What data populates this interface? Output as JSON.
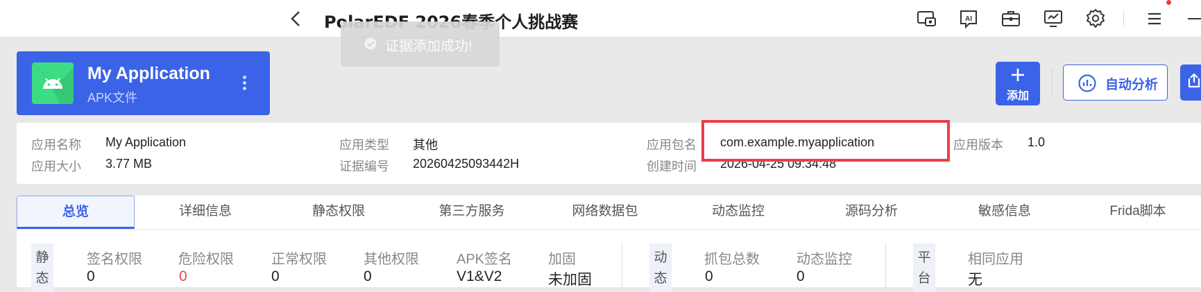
{
  "header": {
    "title": "PolarEDF 2026春季个人挑战赛",
    "toolbar_icons": [
      "screen-record-icon",
      "ai-icon",
      "toolbox-icon",
      "monitor-chart-icon",
      "gear-icon",
      "menu-icon",
      "minimize-icon"
    ]
  },
  "toast": {
    "text": "证据添加成功!"
  },
  "app_card": {
    "name": "My Application",
    "type": "APK文件"
  },
  "actions": {
    "add_label": "添加",
    "auto_analysis_label": "自动分析"
  },
  "info": {
    "app_name_label": "应用名称",
    "app_name": "My Application",
    "app_size_label": "应用大小",
    "app_size": "3.77 MB",
    "app_type_label": "应用类型",
    "app_type": "其他",
    "evidence_id_label": "证据编号",
    "evidence_id": "20260425093442H",
    "package_label": "应用包名",
    "package": "com.example.myapplication",
    "created_label": "创建时间",
    "created": "2026-04-25 09:34:48",
    "version_label": "应用版本",
    "version": "1.0"
  },
  "tabs": [
    "总览",
    "详细信息",
    "静态权限",
    "第三方服务",
    "网络数据包",
    "动态监控",
    "源码分析",
    "敏感信息",
    "Frida脚本"
  ],
  "active_tab": "总览",
  "stats": {
    "static_group": "静态",
    "static": [
      {
        "label": "签名权限",
        "value": "0"
      },
      {
        "label": "危险权限",
        "value": "0"
      },
      {
        "label": "正常权限",
        "value": "0"
      },
      {
        "label": "其他权限",
        "value": "0"
      },
      {
        "label": "APK签名",
        "value": "V1&V2"
      },
      {
        "label": "加固",
        "value": "未加固"
      }
    ],
    "dynamic_group": "动态",
    "dynamic": [
      {
        "label": "抓包总数",
        "value": "0"
      },
      {
        "label": "动态监控",
        "value": "0"
      }
    ],
    "platform_group": "平台",
    "platform": [
      {
        "label": "相同应用",
        "value": "无"
      }
    ]
  },
  "colors": {
    "accent": "#3b63e8",
    "danger": "#ee4444",
    "highlight": "#ea3d47",
    "android_green": "#3ddc84"
  }
}
